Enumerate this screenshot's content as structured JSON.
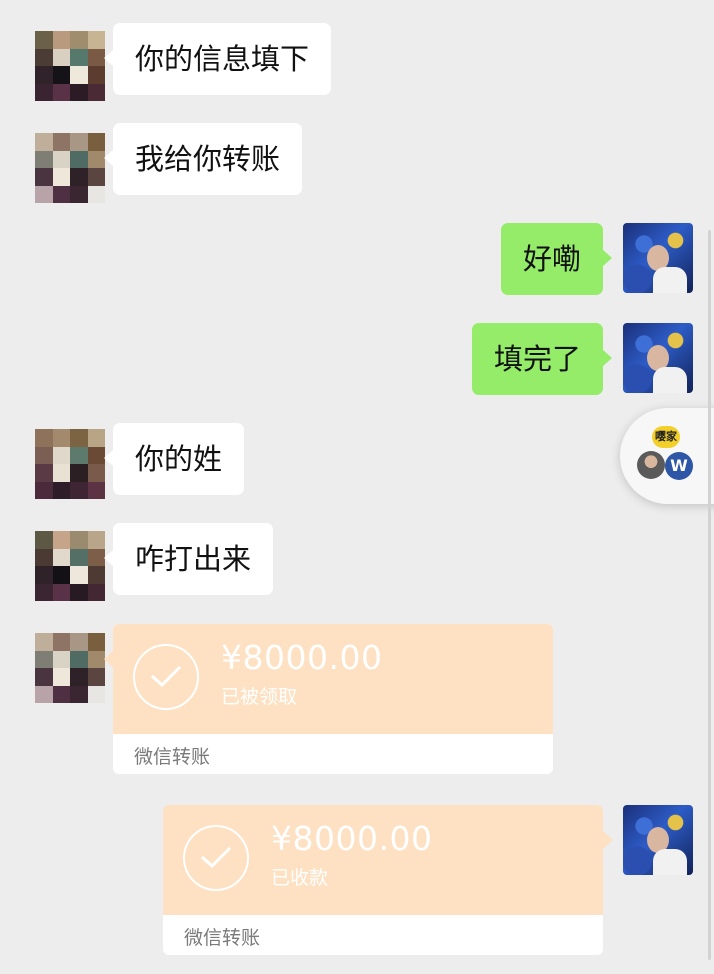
{
  "messages": [
    {
      "direction": "in",
      "text": "你的信息填下"
    },
    {
      "direction": "in",
      "text": "我给你转账"
    },
    {
      "direction": "out",
      "text": "好嘞"
    },
    {
      "direction": "out",
      "text": "填完了"
    },
    {
      "direction": "in",
      "text": "你的姓"
    },
    {
      "direction": "in",
      "text": "咋打出来"
    }
  ],
  "transfers": [
    {
      "direction": "in",
      "amount": "¥8000.00",
      "status": "已被领取",
      "footer": "微信转账"
    },
    {
      "direction": "out",
      "amount": "¥8000.00",
      "status": "已收款",
      "footer": "微信转账"
    }
  ],
  "floating_widget": {
    "app_badge_text": "嘤家",
    "secondary_badge_text": "W"
  },
  "colors": {
    "background": "#ededed",
    "incoming_bubble": "#ffffff",
    "outgoing_bubble": "#95ec69",
    "transfer_card": "#fde1c2"
  },
  "icons": {
    "transfer_status": "check-circle-icon"
  }
}
